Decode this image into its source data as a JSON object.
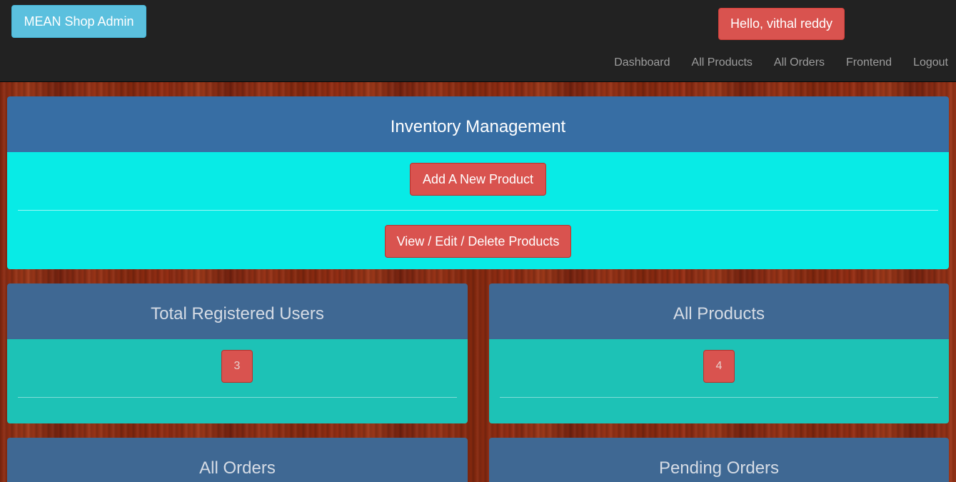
{
  "navbar": {
    "brand": "MEAN Shop Admin",
    "greeting": "Hello, vithal reddy",
    "links": [
      "Dashboard",
      "All Products",
      "All Orders",
      "Frontend",
      "Logout"
    ]
  },
  "inventory": {
    "title": "Inventory Management",
    "add_label": "Add A New Product",
    "view_label": "View / Edit / Delete Products"
  },
  "stats": {
    "users": {
      "title": "Total Registered Users",
      "count": "3"
    },
    "products": {
      "title": "All Products",
      "count": "4"
    },
    "orders": {
      "title": "All Orders"
    },
    "pending": {
      "title": "Pending Orders"
    }
  },
  "colors": {
    "navbar_bg": "#222222",
    "brand_button": "#5bc0de",
    "danger": "#d9534f",
    "panel_heading": "#376ea4",
    "panel_body_inventory": "#08ebe6",
    "panel_body_stats": "#1dc2b6"
  }
}
